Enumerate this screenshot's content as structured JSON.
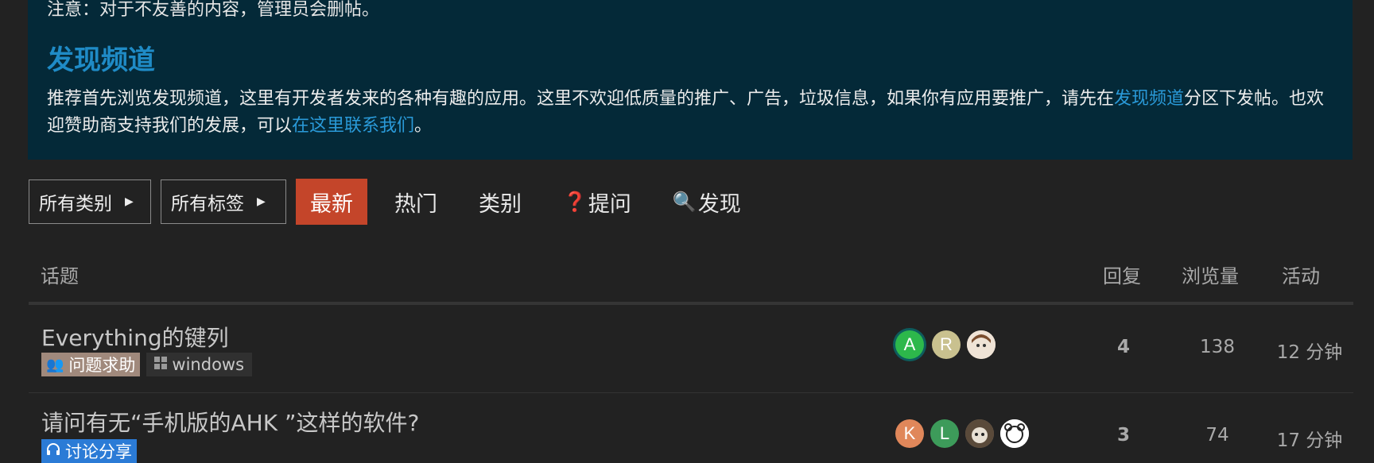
{
  "banner": {
    "notice": "注意：对于不友善的内容，管理员会删帖。",
    "heading": "发现频道",
    "desc_part1": "推荐首先浏览发现频道，这里有开发者发来的各种有趣的应用。这里不欢迎低质量的推广、广告，垃圾信息，如果你有应用要推广，请先在",
    "desc_link1": "发现频道",
    "desc_part2": "分区下发帖。也欢迎赞助商支持我们的发展，可以",
    "desc_link2": "在这里联系我们",
    "desc_part3": "。"
  },
  "nav": {
    "categories_dropdown": "所有类别",
    "tags_dropdown": "所有标签",
    "tabs": [
      {
        "label": "最新",
        "emoji": ""
      },
      {
        "label": "热门",
        "emoji": ""
      },
      {
        "label": "类别",
        "emoji": ""
      },
      {
        "label": "提问",
        "emoji": "❓"
      },
      {
        "label": "发现",
        "emoji": "🔍"
      }
    ]
  },
  "table": {
    "headers": {
      "topic": "话题",
      "replies": "回复",
      "views": "浏览量",
      "activity": "活动"
    },
    "rows": [
      {
        "title": "Everything的键列",
        "tags": [
          {
            "label": "问题求助",
            "icon": "help-people-icon"
          },
          {
            "label": "windows",
            "icon": "windows-icon"
          }
        ],
        "avatars": [
          {
            "letter": "A",
            "color": "#2db84b"
          },
          {
            "letter": "R",
            "color": "#c9c18f"
          },
          {
            "letter": "",
            "color": "#e8d8c8"
          }
        ],
        "replies": "4",
        "views": "138",
        "activity": "12 分钟"
      },
      {
        "title": "请问有无“手机版的AHK ”这样的软件?",
        "tags": [
          {
            "label": "讨论分享",
            "icon": "headphones-icon"
          }
        ],
        "avatars": [
          {
            "letter": "K",
            "color": "#e0875a"
          },
          {
            "letter": "L",
            "color": "#3d9b5a"
          },
          {
            "letter": "",
            "color": "#8a7a6a"
          },
          {
            "letter": "",
            "color": "#ffffff"
          }
        ],
        "replies": "3",
        "views": "74",
        "activity": "17 分钟"
      }
    ]
  },
  "colors": {
    "accent": "#c4452a",
    "banner_bg": "#042938",
    "link": "#2a9ad9"
  }
}
